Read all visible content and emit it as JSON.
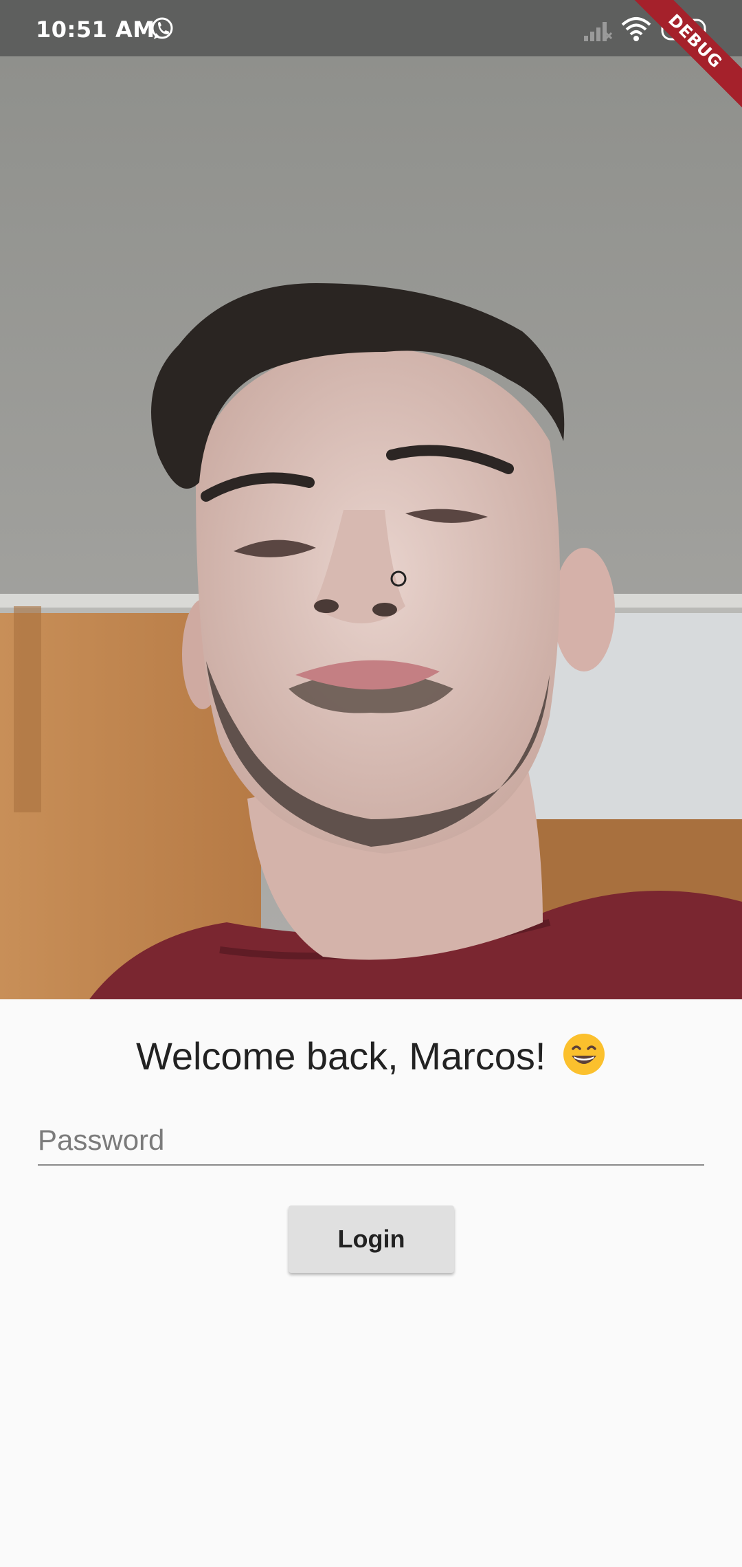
{
  "status_bar": {
    "time": "10:51 AM",
    "icons": [
      "whatsapp-icon",
      "signal-icon",
      "wifi-icon",
      "battery-icon"
    ]
  },
  "debug_banner": "DEBUG",
  "camera": {
    "description_icon": "camera-preview"
  },
  "welcome": {
    "text": "Welcome back, Marcos!",
    "emoji": "grinning-face-emoji"
  },
  "password": {
    "placeholder": "Password",
    "value": ""
  },
  "login_button": {
    "label": "Login"
  },
  "colors": {
    "status_bar": "#5e5f5e",
    "debug_banner": "#a5212b",
    "background": "#fafafa",
    "button": "#e0e0e0"
  }
}
